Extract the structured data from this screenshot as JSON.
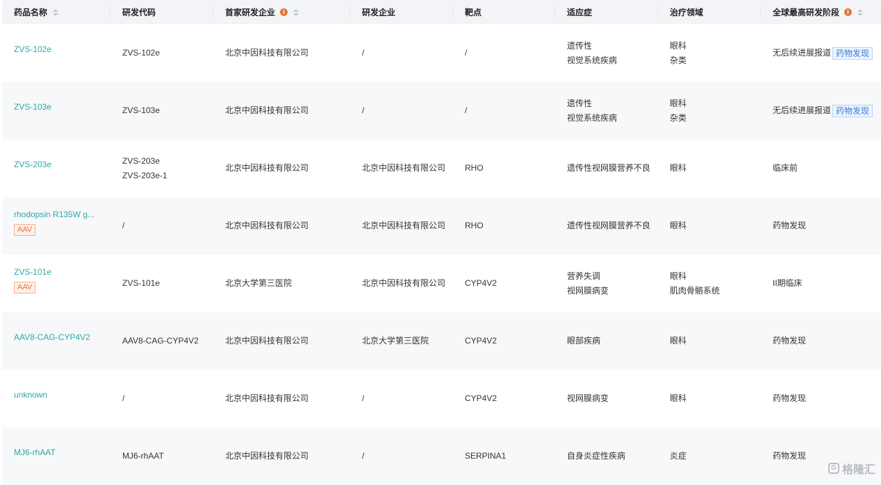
{
  "table": {
    "headers": [
      {
        "label": "药品名称",
        "sortable": true,
        "info": false
      },
      {
        "label": "研发代码",
        "sortable": false,
        "info": false
      },
      {
        "label": "首家研发企业",
        "sortable": true,
        "info": true
      },
      {
        "label": "研发企业",
        "sortable": false,
        "info": false
      },
      {
        "label": "靶点",
        "sortable": false,
        "info": false
      },
      {
        "label": "适应症",
        "sortable": false,
        "info": false
      },
      {
        "label": "治疗领域",
        "sortable": false,
        "info": false
      },
      {
        "label": "全球最高研发阶段",
        "sortable": true,
        "info": true
      }
    ],
    "rows": [
      {
        "drug": "ZVS-102e",
        "tag": "",
        "codes": [
          "ZVS-102e"
        ],
        "first_company": "北京中因科技有限公司",
        "companies": "/",
        "target": "/",
        "indications": [
          "遗传性",
          "视觉系统疾病"
        ],
        "areas": [
          "眼科",
          "杂类"
        ],
        "stage": "无后续进展报道",
        "stage_tag": "药物发现"
      },
      {
        "drug": "ZVS-103e",
        "tag": "",
        "codes": [
          "ZVS-103e"
        ],
        "first_company": "北京中因科技有限公司",
        "companies": "/",
        "target": "/",
        "indications": [
          "遗传性",
          "视觉系统疾病"
        ],
        "areas": [
          "眼科",
          "杂类"
        ],
        "stage": "无后续进展报道",
        "stage_tag": "药物发现"
      },
      {
        "drug": "ZVS-203e",
        "tag": "",
        "codes": [
          "ZVS-203e",
          "ZVS-203e-1"
        ],
        "first_company": "北京中因科技有限公司",
        "companies": "北京中因科技有限公司",
        "target": "RHO",
        "indications": [
          "遗传性视网膜营养不良"
        ],
        "areas": [
          "眼科"
        ],
        "stage": "临床前",
        "stage_tag": ""
      },
      {
        "drug": "rhodopsin R135W g...",
        "tag": "AAV",
        "codes": [
          "/"
        ],
        "first_company": "北京中因科技有限公司",
        "companies": "北京中因科技有限公司",
        "target": "RHO",
        "indications": [
          "遗传性视网膜营养不良"
        ],
        "areas": [
          "眼科"
        ],
        "stage": "药物发现",
        "stage_tag": ""
      },
      {
        "drug": "ZVS-101e",
        "tag": "AAV",
        "codes": [
          "ZVS-101e"
        ],
        "first_company": "北京大学第三医院",
        "companies": "北京中因科技有限公司",
        "target": "CYP4V2",
        "indications": [
          "营养失调",
          "视网膜病变"
        ],
        "areas": [
          "眼科",
          "肌肉骨骼系统"
        ],
        "stage": "II期临床",
        "stage_tag": ""
      },
      {
        "drug": "AAV8-CAG-CYP4V2",
        "tag": "",
        "codes": [
          "AAV8-CAG-CYP4V2"
        ],
        "first_company": "北京中因科技有限公司",
        "companies": "北京大学第三医院",
        "target": "CYP4V2",
        "indications": [
          "眼部疾病"
        ],
        "areas": [
          "眼科"
        ],
        "stage": "药物发现",
        "stage_tag": ""
      },
      {
        "drug": "unknown",
        "tag": "",
        "codes": [
          "/"
        ],
        "first_company": "北京中因科技有限公司",
        "companies": "/",
        "target": "CYP4V2",
        "indications": [
          "视网膜病变"
        ],
        "areas": [
          "眼科"
        ],
        "stage": "药物发现",
        "stage_tag": ""
      },
      {
        "drug": "MJ6-rhAAT",
        "tag": "",
        "codes": [
          "MJ6-rhAAT"
        ],
        "first_company": "北京中因科技有限公司",
        "companies": "/",
        "target": "SERPINA1",
        "indications": [
          "自身炎症性疾病"
        ],
        "areas": [
          "炎症"
        ],
        "stage": "药物发现",
        "stage_tag": ""
      }
    ]
  },
  "watermark": {
    "text": "格隆汇",
    "icon": "g-logo-icon"
  },
  "colors": {
    "link": "#2ba8a8",
    "tag_orange": "#e8743b",
    "tag_blue": "#3a7bd5",
    "header_bg": "#f2f4f7"
  }
}
